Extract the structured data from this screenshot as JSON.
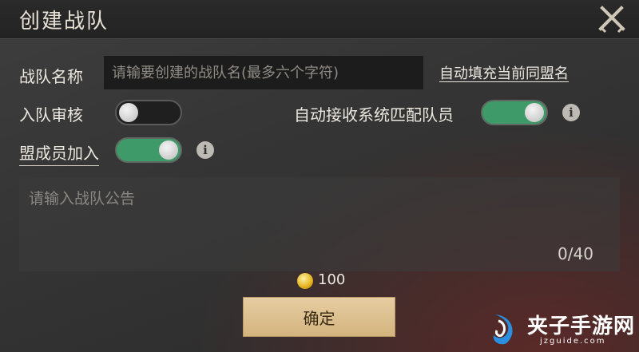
{
  "header": {
    "title": "创建战队"
  },
  "form": {
    "team_name_label": "战队名称",
    "team_name_placeholder": "请输要创建的战队名(最多六个字符)",
    "autofill_link": "自动填充当前同盟名",
    "review_label": "入队审核",
    "review_on": false,
    "auto_accept_label": "自动接收系统匹配队员",
    "auto_accept_on": true,
    "alliance_join_label": "盟成员加入",
    "alliance_join_on": true,
    "info_glyph": "i",
    "notice_placeholder": "请输入战队公告",
    "char_count": "0/40"
  },
  "footer": {
    "cost_icon": "gold-coin-icon",
    "cost_value": "100",
    "confirm_label": "确定"
  },
  "watermark": {
    "text_cn": "夹子手游网",
    "text_en": "jzguide.com"
  },
  "colors": {
    "toggle_on": "#3f9a6a",
    "button_bg": "#e0c594",
    "accent_gold": "#e4b21c"
  }
}
